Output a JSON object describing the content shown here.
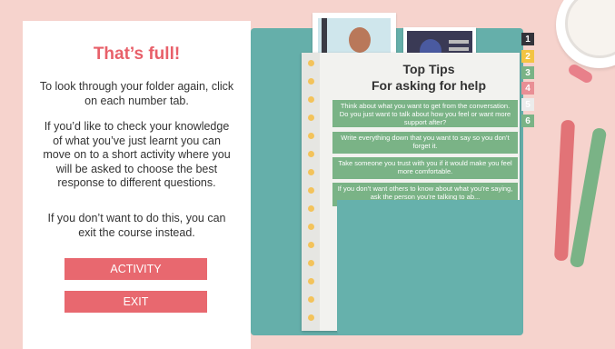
{
  "panel": {
    "title": "That’s full!",
    "para1": "To look through your folder again, click on each number tab.",
    "para2": "If you’d like to check your knowledge of what you’ve just learnt you can move on to a short activity where you will be asked to choose the best response to different questions.",
    "para3": "If you don’t want to do this, you can exit the course instead.",
    "activity_label": "ACTIVITY",
    "exit_label": "EXIT"
  },
  "notepad": {
    "title_line1": "Top Tips",
    "title_line2": "For asking for help",
    "tips": [
      "Think about what you want to get from the conversation. Do you just want to talk about how you feel or want more support after?",
      "Write everything down that you want to say so you don’t forget it.",
      "Take someone you trust with you if it would make you feel more comfortable.",
      "If you don’t want others to know about what you’re saying, ask the person you’re talking to ab..."
    ]
  },
  "tabs": [
    "1",
    "2",
    "3",
    "4",
    "5",
    "6"
  ],
  "colors": {
    "background": "#f6d3cd",
    "accent_red": "#e8686f",
    "folder_teal": "#65afaa",
    "tip_green": "#7ab386"
  }
}
